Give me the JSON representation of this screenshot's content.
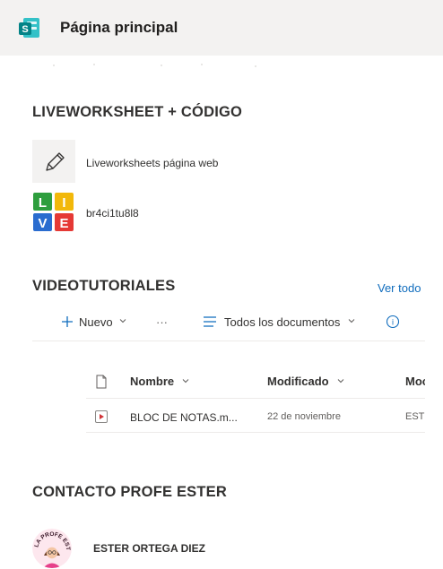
{
  "header": {
    "title": "Página principal",
    "icon": "sharepoint-icon",
    "colors": {
      "bg": "#f3f2f1",
      "brand": "#038387"
    }
  },
  "quick_links": {
    "title": "LIVEWORKSHEET + CÓDIGO",
    "items": [
      {
        "label": "Liveworksheets página web",
        "icon": "pencil-icon"
      },
      {
        "label": "br4ci1tu8l8",
        "icon": "live-logo-icon"
      }
    ]
  },
  "live_logo": {
    "letters": [
      "L",
      "I",
      "V",
      "E"
    ],
    "colors": [
      "#2e9e3e",
      "#f2b80a",
      "#2a6ccf",
      "#e53935"
    ]
  },
  "videos": {
    "title": "VIDEOTUTORIALES",
    "see_all": "Ver todo",
    "commands": {
      "new_label": "Nuevo",
      "more": "···",
      "view_label": "Todos los documentos",
      "info": "i"
    },
    "columns": [
      "Nombre",
      "Modificado",
      "Moc"
    ],
    "rows": [
      {
        "name": "BLOC DE NOTAS.m...",
        "modified": "22 de noviembre",
        "modified_by": "ESTE"
      }
    ]
  },
  "contact": {
    "title": "CONTACTO PROFE ESTER",
    "name": "ESTER ORTEGA DIEZ",
    "avatar_text": "LA PROFE ESTER"
  },
  "accent": "#0f6cbd"
}
